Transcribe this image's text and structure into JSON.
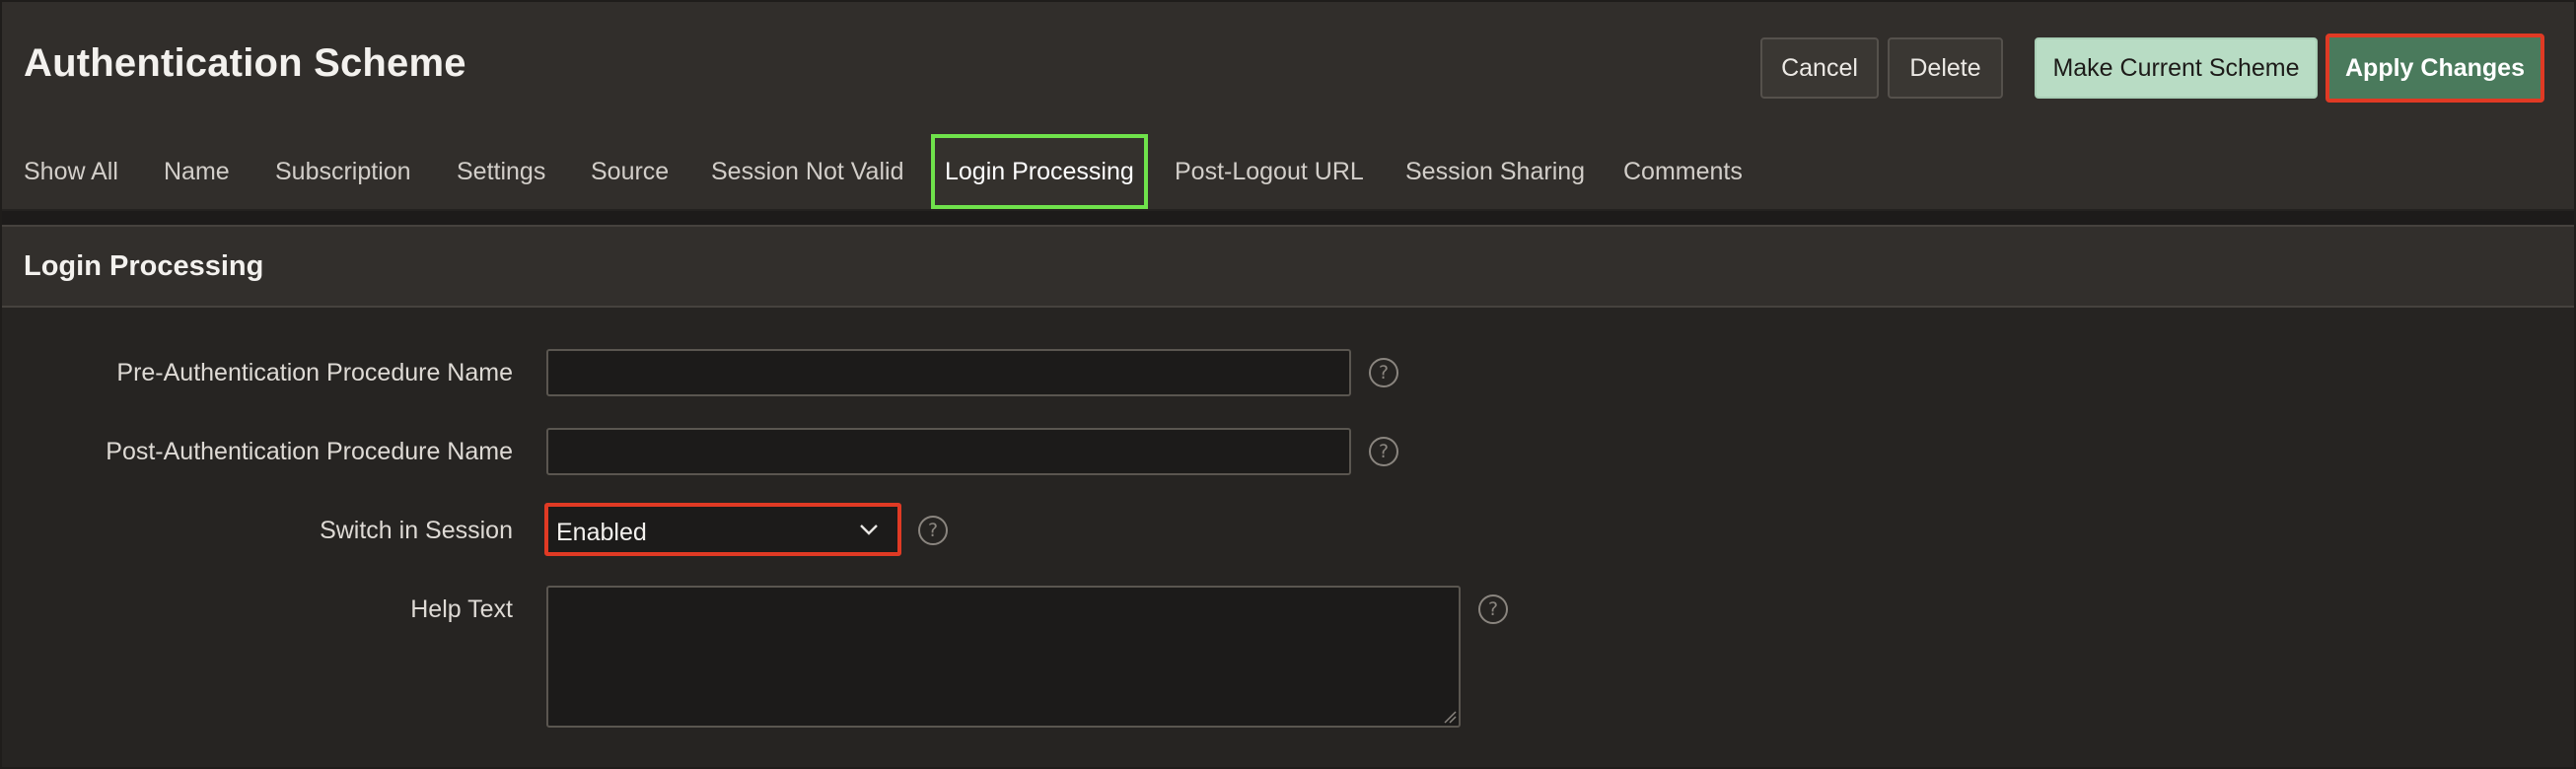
{
  "header": {
    "title": "Authentication Scheme",
    "buttons": {
      "cancel": "Cancel",
      "delete": "Delete",
      "make_current": "Make Current Scheme",
      "apply": "Apply Changes"
    }
  },
  "tabs": [
    {
      "label": "Show All"
    },
    {
      "label": "Name"
    },
    {
      "label": "Subscription"
    },
    {
      "label": "Settings"
    },
    {
      "label": "Source"
    },
    {
      "label": "Session Not Valid"
    },
    {
      "label": "Login Processing",
      "active": true
    },
    {
      "label": "Post-Logout URL"
    },
    {
      "label": "Session Sharing"
    },
    {
      "label": "Comments"
    }
  ],
  "region": {
    "title": "Login Processing",
    "fields": {
      "pre_auth": {
        "label": "Pre-Authentication Procedure Name",
        "value": ""
      },
      "post_auth": {
        "label": "Post-Authentication Procedure Name",
        "value": ""
      },
      "switch_in_session": {
        "label": "Switch in Session",
        "value": "Enabled"
      },
      "help_text": {
        "label": "Help Text",
        "value": ""
      }
    },
    "help_glyph": "?"
  },
  "colors": {
    "accent_green": "#6fe24b",
    "highlight_red": "#e03a24",
    "apply_button": "#4a7a5c",
    "make_current_button": "#b8dcc4"
  }
}
